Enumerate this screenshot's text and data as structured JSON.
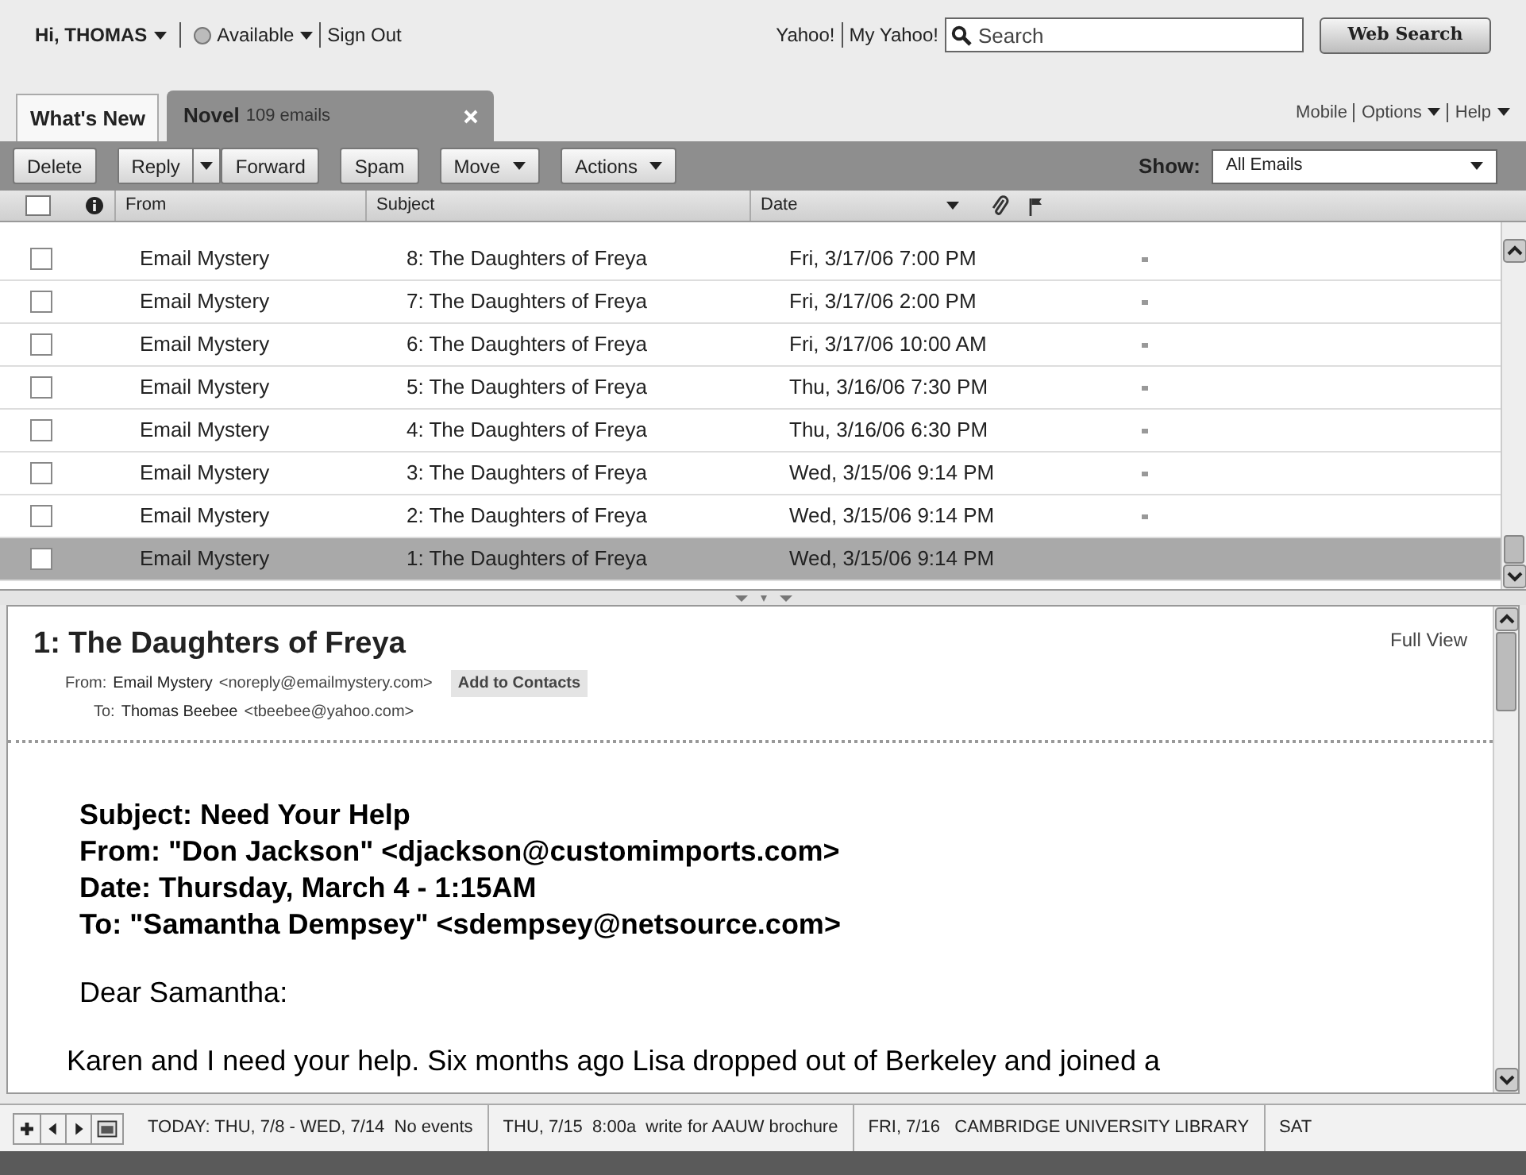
{
  "user_bar": {
    "greeting": "Hi, THOMAS",
    "status": "Available",
    "sign_out": "Sign Out",
    "links": [
      "Yahoo!",
      "My Yahoo!"
    ],
    "search": {
      "placeholder": "Search"
    },
    "search_button": "Web Search"
  },
  "tabs": [
    {
      "label": "What's New",
      "selected": false,
      "closable": false
    },
    {
      "label": "Novel",
      "count": "109 emails",
      "selected": true,
      "closable": true
    }
  ],
  "top_right_links": [
    {
      "label": "Mobile",
      "menu": false
    },
    {
      "label": "Options",
      "menu": true
    },
    {
      "label": "Help",
      "menu": true
    }
  ],
  "toolbar": [
    {
      "label": "Delete",
      "kind": "plain"
    },
    {
      "label": "Reply",
      "kind": "split"
    },
    {
      "label": "Forward",
      "kind": "plain"
    },
    {
      "label": "Spam",
      "kind": "plain"
    },
    {
      "label": "Move",
      "kind": "menu"
    },
    {
      "label": "Actions",
      "kind": "menu"
    }
  ],
  "show": {
    "label": "Show:",
    "value": "All Emails"
  },
  "select_all": {
    "checked": false
  },
  "columns": [
    "From",
    "Subject",
    "Date"
  ],
  "rows": [
    {
      "from": "Email Mystery",
      "subject": "8: The Daughters of Freya",
      "date": "Fri, 3/17/06 7:00 PM",
      "checked": false,
      "selected": false,
      "marked": true
    },
    {
      "from": "Email Mystery",
      "subject": "7: The Daughters of Freya",
      "date": "Fri, 3/17/06 2:00 PM",
      "checked": false,
      "selected": false,
      "marked": true
    },
    {
      "from": "Email Mystery",
      "subject": "6: The Daughters of Freya",
      "date": "Fri, 3/17/06 10:00 AM",
      "checked": false,
      "selected": false,
      "marked": true
    },
    {
      "from": "Email Mystery",
      "subject": "5: The Daughters of Freya",
      "date": "Thu, 3/16/06 7:30 PM",
      "checked": false,
      "selected": false,
      "marked": true
    },
    {
      "from": "Email Mystery",
      "subject": "4: The Daughters of Freya",
      "date": "Thu, 3/16/06 6:30 PM",
      "checked": false,
      "selected": false,
      "marked": true
    },
    {
      "from": "Email Mystery",
      "subject": "3: The Daughters of Freya",
      "date": "Wed, 3/15/06 9:14 PM",
      "checked": false,
      "selected": false,
      "marked": true
    },
    {
      "from": "Email Mystery",
      "subject": "2: The Daughters of Freya",
      "date": "Wed, 3/15/06 9:14 PM",
      "checked": false,
      "selected": false,
      "marked": true
    },
    {
      "from": "Email Mystery",
      "subject": "1: The Daughters of Freya",
      "date": "Wed, 3/15/06 9:14 PM",
      "checked": false,
      "selected": true,
      "marked": false
    }
  ],
  "message": {
    "title": "1: The Daughters of Freya",
    "full_view": "Full View",
    "from_label": "From:",
    "from_name": "Email Mystery",
    "from_address": "<noreply@emailmystery.com>",
    "add_to_contacts": "Add to Contacts",
    "to_label": "To:",
    "to_name": "Thomas Beebee",
    "to_address": "<tbeebee@yahoo.com>",
    "header_lines": [
      "Subject: Need Your Help",
      "From: \"Don Jackson\" <djackson@customimports.com>",
      "Date: Thursday, March 4 - 1:15AM",
      "To: \"Samantha Dempsey\" <sdempsey@netsource.com>"
    ],
    "paragraphs": [
      "Dear Samantha:",
      "Karen and I need your help. Six months ago Lisa dropped out of Berkeley and joined a"
    ]
  },
  "calendar": {
    "events": [
      {
        "label": "TODAY: THU, 7/8 - WED, 7/14  No events"
      },
      {
        "label": "THU, 7/15  8:00a  write for AAUW brochure"
      },
      {
        "label": "FRI, 7/16   CAMBRIDGE UNIVERSITY LIBRARY"
      },
      {
        "label": "SAT"
      }
    ]
  }
}
